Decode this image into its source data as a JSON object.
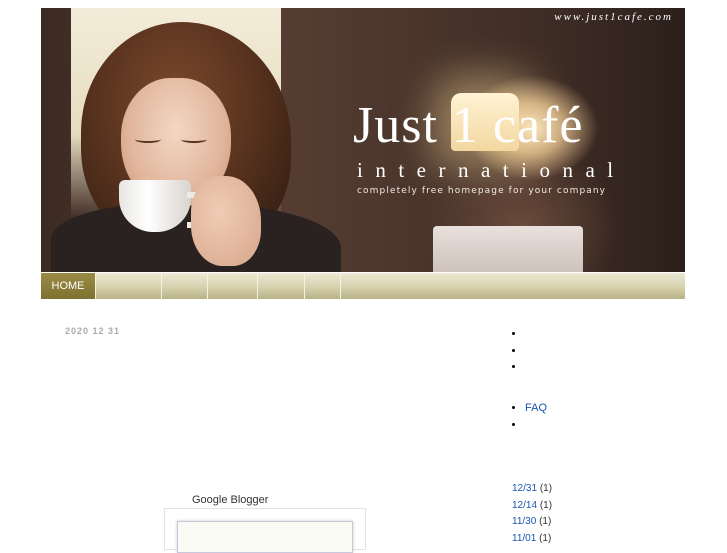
{
  "header": {
    "url": "www.just1cafe.com",
    "title": "Just 1 café",
    "subtitle": "international",
    "tagline": "completely free homepage for your company"
  },
  "nav": {
    "items": [
      {
        "label": "HOME",
        "active": true
      },
      {
        "label": "",
        "active": false
      },
      {
        "label": "",
        "active": false
      },
      {
        "label": "",
        "active": false
      },
      {
        "label": "",
        "active": false
      },
      {
        "label": "",
        "active": false
      },
      {
        "label": "",
        "active": false
      }
    ]
  },
  "main": {
    "post_date": "2020  12  31",
    "widget_label": "Google Blogger"
  },
  "sidebar": {
    "list1": [
      "",
      "",
      ""
    ],
    "list2": [
      {
        "label": "FAQ"
      },
      {
        "label": ""
      }
    ],
    "archive": [
      {
        "date": "12/31",
        "count": "(1)"
      },
      {
        "date": "12/14",
        "count": "(1)"
      },
      {
        "date": "11/30",
        "count": "(1)"
      },
      {
        "date": "11/01",
        "count": "(1)"
      }
    ]
  }
}
